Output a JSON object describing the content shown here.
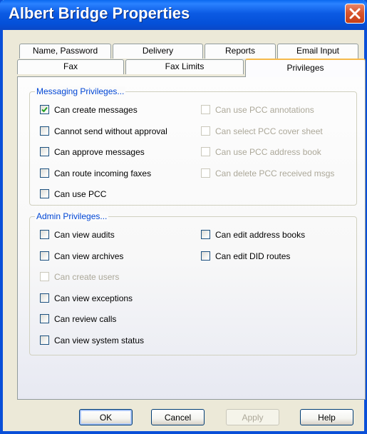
{
  "window": {
    "title": "Albert Bridge Properties"
  },
  "tabs": {
    "row1": [
      {
        "label": "Name, Password"
      },
      {
        "label": "Delivery"
      },
      {
        "label": "Reports"
      },
      {
        "label": "Email Input"
      }
    ],
    "row2": [
      {
        "label": "Fax"
      },
      {
        "label": "Fax Limits"
      },
      {
        "label": "Privileges",
        "active": true
      }
    ]
  },
  "messaging": {
    "title": "Messaging Privileges...",
    "left": [
      {
        "label": "Can create messages",
        "checked": true,
        "enabled": true
      },
      {
        "label": "Cannot send without approval",
        "checked": false,
        "enabled": true
      },
      {
        "label": "Can approve messages",
        "checked": false,
        "enabled": true
      },
      {
        "label": "Can route incoming faxes",
        "checked": false,
        "enabled": true
      },
      {
        "label": "Can use PCC",
        "checked": false,
        "enabled": true
      }
    ],
    "right": [
      {
        "label": "Can use PCC annotations",
        "checked": false,
        "enabled": false
      },
      {
        "label": "Can select PCC cover sheet",
        "checked": false,
        "enabled": false
      },
      {
        "label": "Can use PCC address book",
        "checked": false,
        "enabled": false
      },
      {
        "label": "Can delete PCC received msgs",
        "checked": false,
        "enabled": false
      }
    ]
  },
  "admin": {
    "title": "Admin Privileges...",
    "left": [
      {
        "label": "Can view audits",
        "checked": false,
        "enabled": true
      },
      {
        "label": "Can view archives",
        "checked": false,
        "enabled": true
      },
      {
        "label": "Can create users",
        "checked": false,
        "enabled": false
      },
      {
        "label": "Can view exceptions",
        "checked": false,
        "enabled": true
      },
      {
        "label": "Can review calls",
        "checked": false,
        "enabled": true
      },
      {
        "label": "Can view system status",
        "checked": false,
        "enabled": true
      }
    ],
    "right": [
      {
        "label": "Can edit address books",
        "checked": false,
        "enabled": true
      },
      {
        "label": "Can edit DID routes",
        "checked": false,
        "enabled": true
      }
    ]
  },
  "buttons": {
    "ok": "OK",
    "cancel": "Cancel",
    "apply": "Apply",
    "help": "Help"
  },
  "colors": {
    "titlebar": "#0a5ae3",
    "group_title": "#0046d5",
    "active_tab_accent": "#f5b94a",
    "close_button": "#d9552e"
  }
}
